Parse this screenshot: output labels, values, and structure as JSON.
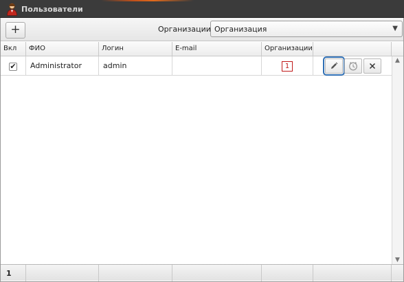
{
  "window": {
    "title": "Пользователи"
  },
  "toolbar": {
    "add_label": "+",
    "org_filter_label": "Организации",
    "org_filter_value": "Организация"
  },
  "table": {
    "columns": [
      "Вкл",
      "ФИО",
      "Логин",
      "E-mail",
      "Организации"
    ],
    "rows": [
      {
        "enabled": true,
        "full_name": "Administrator",
        "login": "admin",
        "email": "",
        "organizations": "1"
      }
    ],
    "footer_count": "1"
  },
  "icons": {
    "app": "user-icon",
    "edit": "pencil-icon",
    "history": "clock-icon",
    "delete": "close-icon"
  }
}
